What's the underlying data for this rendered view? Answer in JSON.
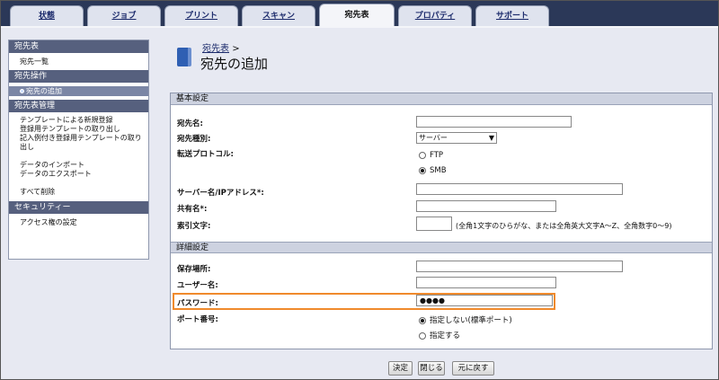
{
  "tabs": [
    {
      "label": "状態"
    },
    {
      "label": "ジョブ"
    },
    {
      "label": "プリント"
    },
    {
      "label": "スキャン"
    },
    {
      "label": "宛先表"
    },
    {
      "label": "プロパティ"
    },
    {
      "label": "サポート"
    }
  ],
  "sidebar": {
    "sections": [
      {
        "header": "宛先表",
        "items": [
          "宛先一覧"
        ]
      },
      {
        "header": "宛先操作",
        "selected": "宛先の追加"
      },
      {
        "header": "宛先表管理",
        "items": [
          "テンプレートによる新規登録",
          "登録用テンプレートの取り出し",
          "記入例付き登録用テンプレートの取り出し",
          "データのインポート",
          "データのエクスポート",
          "すべて削除"
        ]
      },
      {
        "header": "セキュリティー",
        "items": [
          "アクセス権の設定"
        ]
      }
    ]
  },
  "breadcrumb": {
    "link": "宛先表",
    "sep": ">"
  },
  "page_title": "宛先の追加",
  "basic": {
    "title": "基本設定",
    "name_label": "宛先名:",
    "type_label": "宛先種別:",
    "type_value": "サーバー",
    "protocol_label": "転送プロトコル:",
    "ftp": "FTP",
    "smb": "SMB",
    "server_label": "サーバー名/IPアドレス*:",
    "share_label": "共有名*:",
    "index_label": "索引文字:",
    "index_note": "(全角1文字のひらがな、または全角英大文字A～Z、全角数字0～9)"
  },
  "detail": {
    "title": "詳細設定",
    "path_label": "保存場所:",
    "user_label": "ユーザー名:",
    "password_label": "パスワード:",
    "password_value": "●●●●",
    "port_label": "ポート番号:",
    "port_default": "指定しない(標準ポート)",
    "port_specify": "指定する"
  },
  "buttons": {
    "ok": "決定",
    "close": "閉じる",
    "undo": "元に戻す"
  }
}
